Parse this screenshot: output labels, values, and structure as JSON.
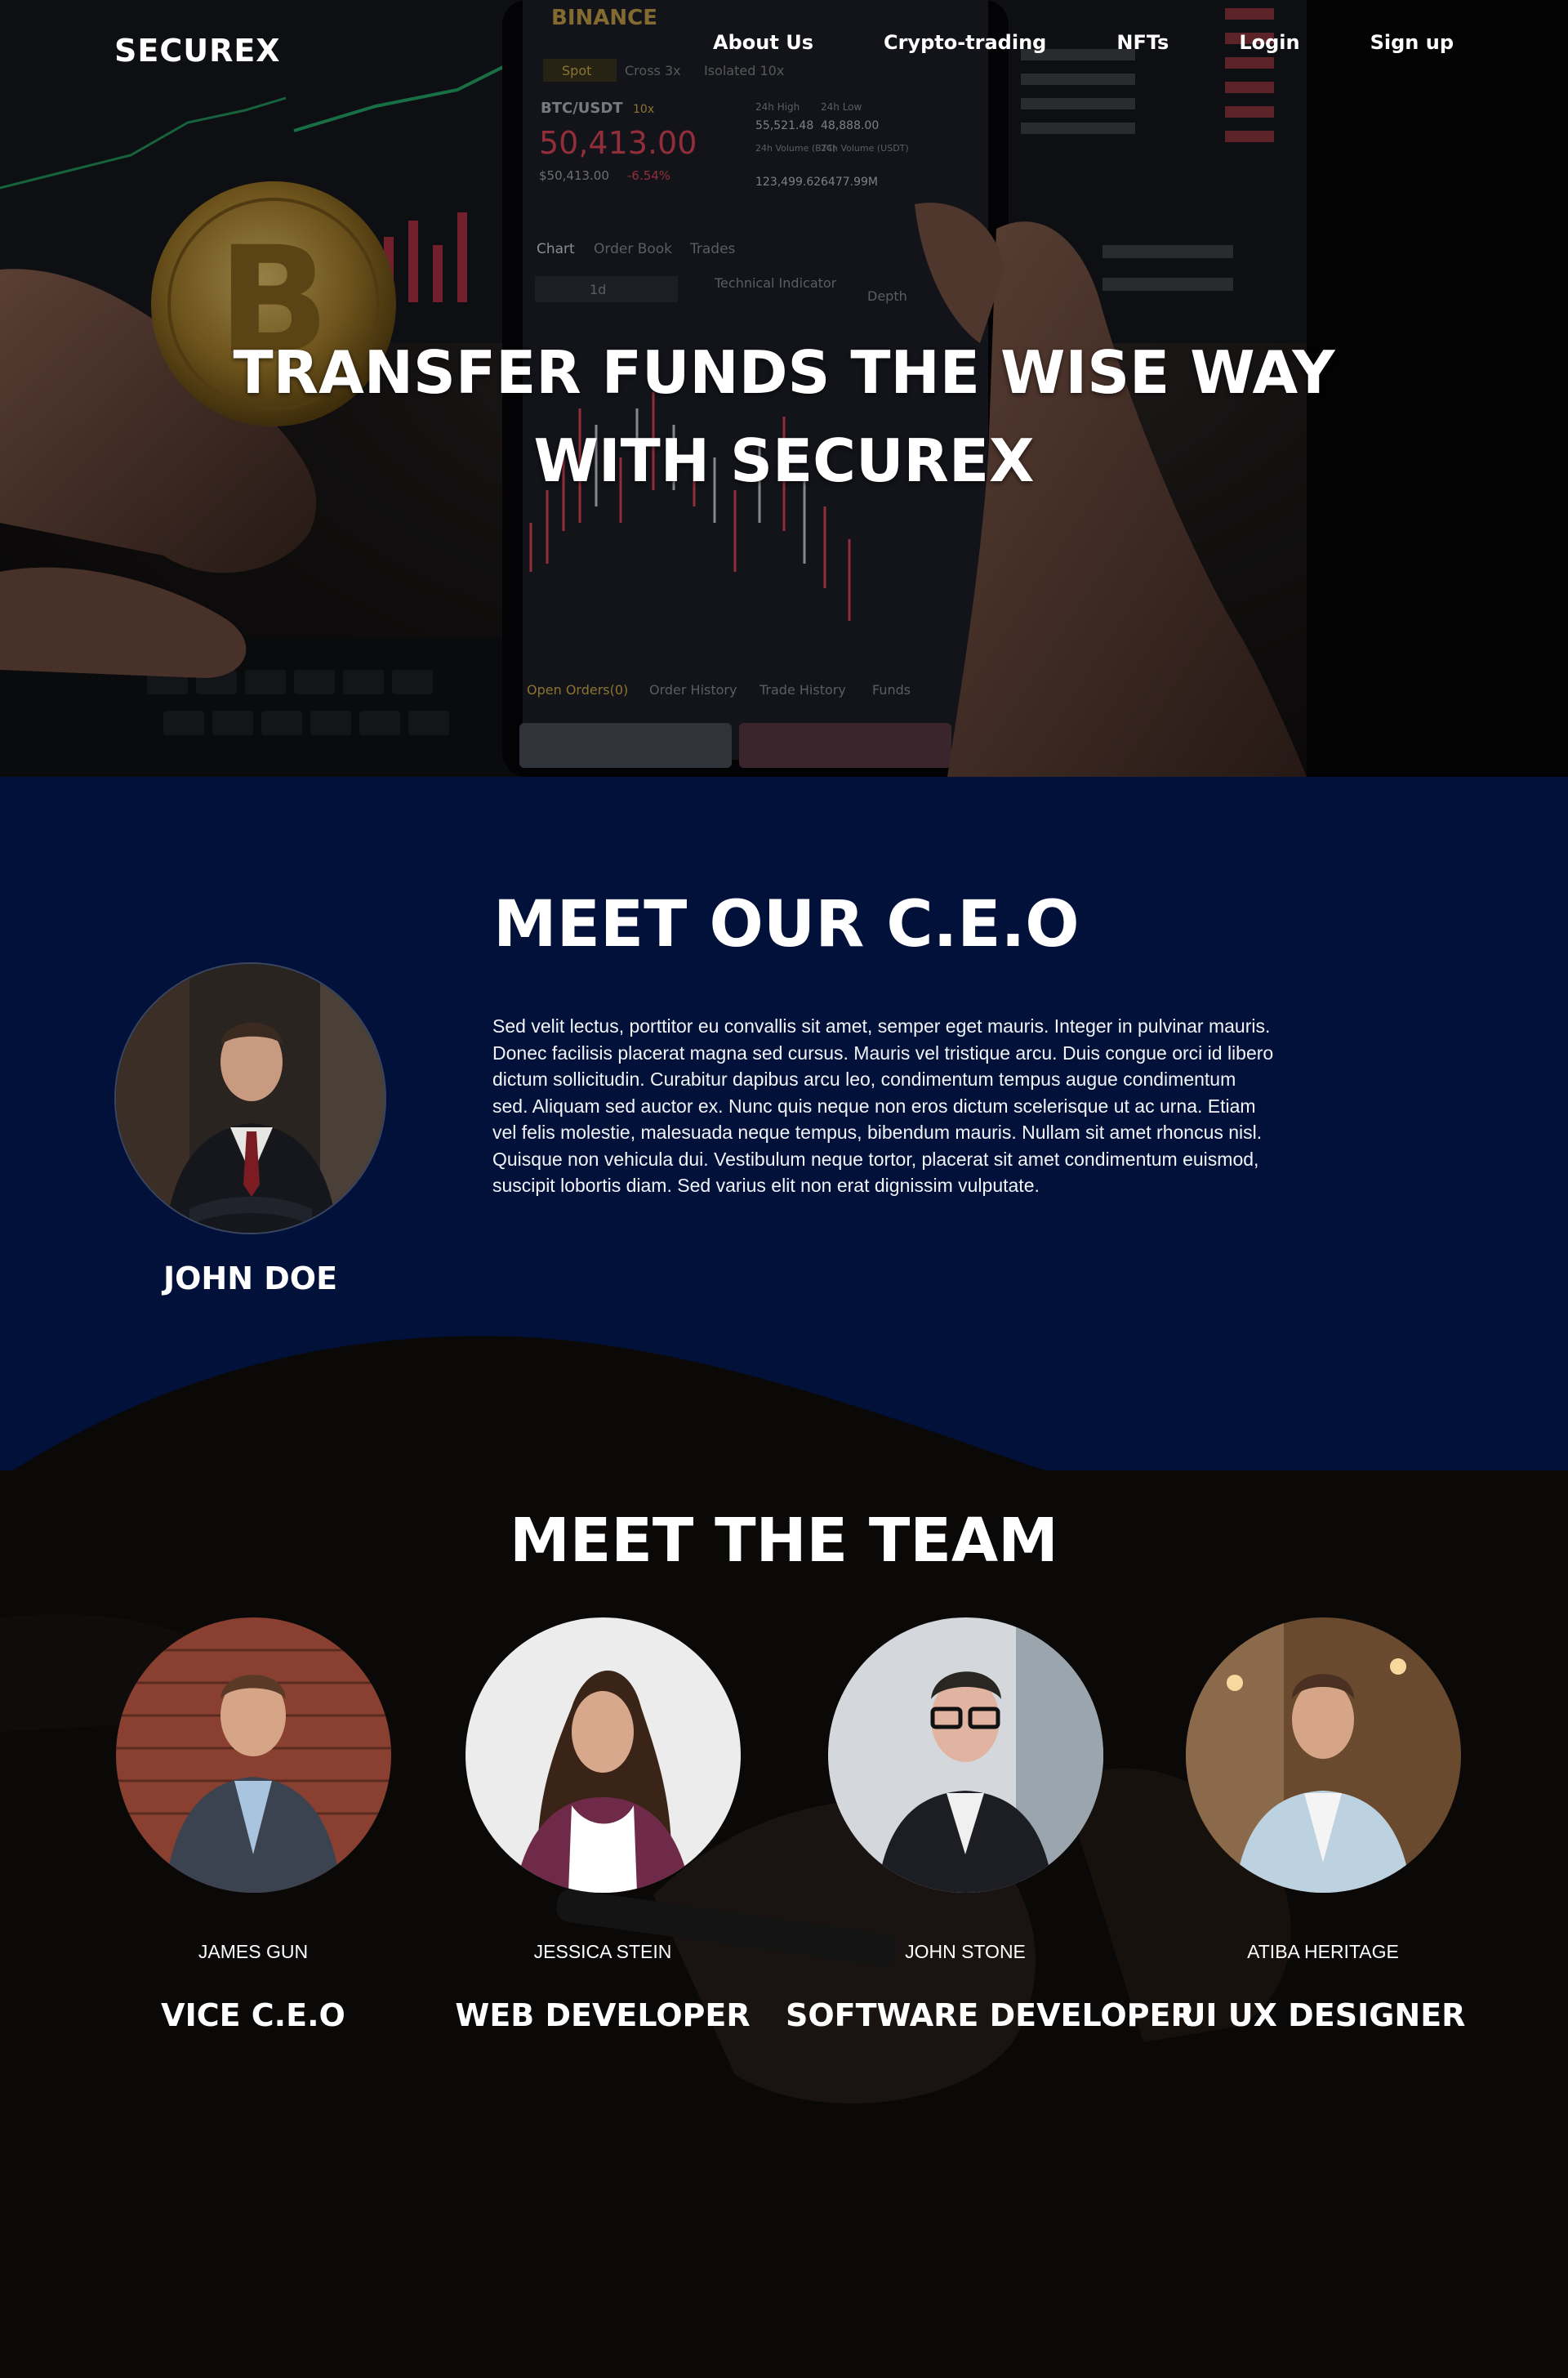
{
  "brand": "SECUREX",
  "nav": {
    "links": [
      "About Us",
      "Crypto-trading",
      "NFTs",
      "Login",
      "Sign up"
    ]
  },
  "hero": {
    "title_line1": "TRANSFER FUNDS THE WISE WAY",
    "title_line2": "WITH SECUREX",
    "phone_app": {
      "exchange": "BINANCE",
      "tabs": [
        "Spot",
        "Cross 3x",
        "Isolated 10x"
      ],
      "pair": "BTC/USDT",
      "leverage": "10x",
      "price": "50,413.00",
      "sub_price": "$50,413.00",
      "change": "-6.54%",
      "stats": [
        "24h High",
        "55,521.48",
        "24h Low",
        "48,888.00",
        "24h Volume (BTC)",
        "24h Volume (USDT)",
        "123,499.62",
        "6477.99M"
      ],
      "chart_tabs": [
        "Chart",
        "Order Book",
        "Trades"
      ],
      "interval": "1d",
      "indicator": "Technical Indicator",
      "depth": "Depth",
      "bottom_tabs": [
        "Open Orders(0)",
        "Order History",
        "Trade History",
        "Funds"
      ]
    }
  },
  "ceo": {
    "heading": "MEET OUR C.E.O",
    "name": "JOHN DOE",
    "bio": "Sed velit lectus, porttitor eu convallis sit amet, semper eget mauris. Integer in pulvinar mauris. Donec facilisis placerat magna sed cursus. Mauris vel tristique arcu. Duis congue orci id libero dictum sollicitudin. Curabitur dapibus arcu leo, condimentum tempus augue condimentum sed. Aliquam sed auctor ex. Nunc quis neque non eros dictum scelerisque ut ac urna. Etiam vel felis molestie, malesuada neque tempus, bibendum mauris. Nullam sit amet rhoncus nisl. Quisque non vehicula dui. Vestibulum neque tortor, placerat sit amet condimentum euismod, suscipit lobortis diam. Sed varius elit non erat dignissim vulputate."
  },
  "team": {
    "heading": "MEET THE TEAM",
    "members": [
      {
        "name": "JAMES GUN",
        "role": "VICE C.E.O"
      },
      {
        "name": "JESSICA STEIN",
        "role": "WEB DEVELOPER"
      },
      {
        "name": "JOHN STONE",
        "role": "SOFTWARE DEVELOPER"
      },
      {
        "name": "ATIBA HERITAGE",
        "role": "UI UX DESIGNER"
      }
    ]
  },
  "colors": {
    "ceo_bg": "#01113a",
    "team_bg": "#0b0808",
    "text": "#ffffff",
    "price_red": "#e0455a"
  }
}
